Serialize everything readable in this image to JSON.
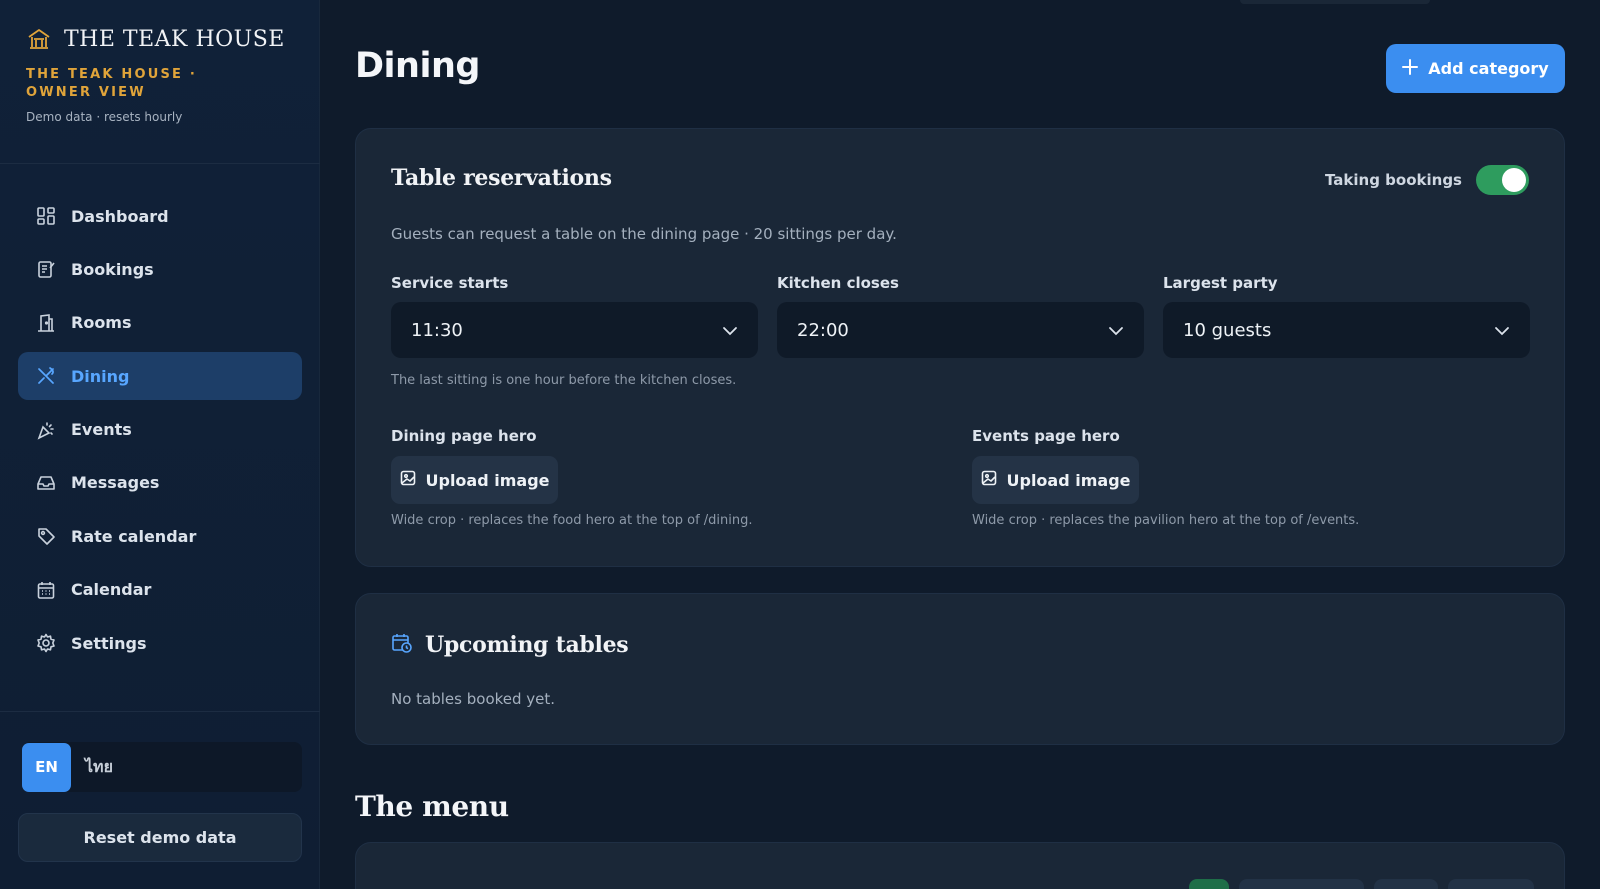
{
  "brand": {
    "name": "THE TEAK HOUSE",
    "subtitle": "THE TEAK HOUSE · OWNER VIEW",
    "note": "Demo data · resets hourly",
    "accent_color": "#e0a43a"
  },
  "sidebar": {
    "items": [
      {
        "label": "Dashboard",
        "icon": "dashboard-icon"
      },
      {
        "label": "Bookings",
        "icon": "bookings-icon"
      },
      {
        "label": "Rooms",
        "icon": "rooms-icon"
      },
      {
        "label": "Dining",
        "icon": "dining-icon",
        "active": true
      },
      {
        "label": "Events",
        "icon": "events-icon"
      },
      {
        "label": "Messages",
        "icon": "messages-icon"
      },
      {
        "label": "Rate calendar",
        "icon": "rate-tag-icon"
      },
      {
        "label": "Calendar",
        "icon": "calendar-icon"
      },
      {
        "label": "Settings",
        "icon": "gear-icon"
      }
    ],
    "language": {
      "selected": "EN",
      "other": "ไทย"
    },
    "reset_label": "Reset demo data"
  },
  "page": {
    "title": "Dining",
    "add_label": "Add category",
    "accent_color": "#3b8ef0"
  },
  "reservations": {
    "title": "Table reservations",
    "toggle_label": "Taking bookings",
    "toggle_on": true,
    "description": "Guests can request a table on the dining page · 20 sittings per day.",
    "service_starts": {
      "label": "Service starts",
      "value": "11:30"
    },
    "kitchen_closes": {
      "label": "Kitchen closes",
      "value": "22:00"
    },
    "largest_party": {
      "label": "Largest party",
      "value": "10 guests"
    },
    "hint": "The last sitting is one hour before the kitchen closes.",
    "dining_hero": {
      "label": "Dining page hero",
      "button": "Upload image",
      "hint": "Wide crop · replaces the food hero at the top of /dining."
    },
    "events_hero": {
      "label": "Events page hero",
      "button": "Upload image",
      "hint": "Wide crop · replaces the pavilion hero at the top of /events."
    }
  },
  "upcoming": {
    "title": "Upcoming tables",
    "empty": "No tables booked yet."
  },
  "menu": {
    "title": "The menu"
  }
}
